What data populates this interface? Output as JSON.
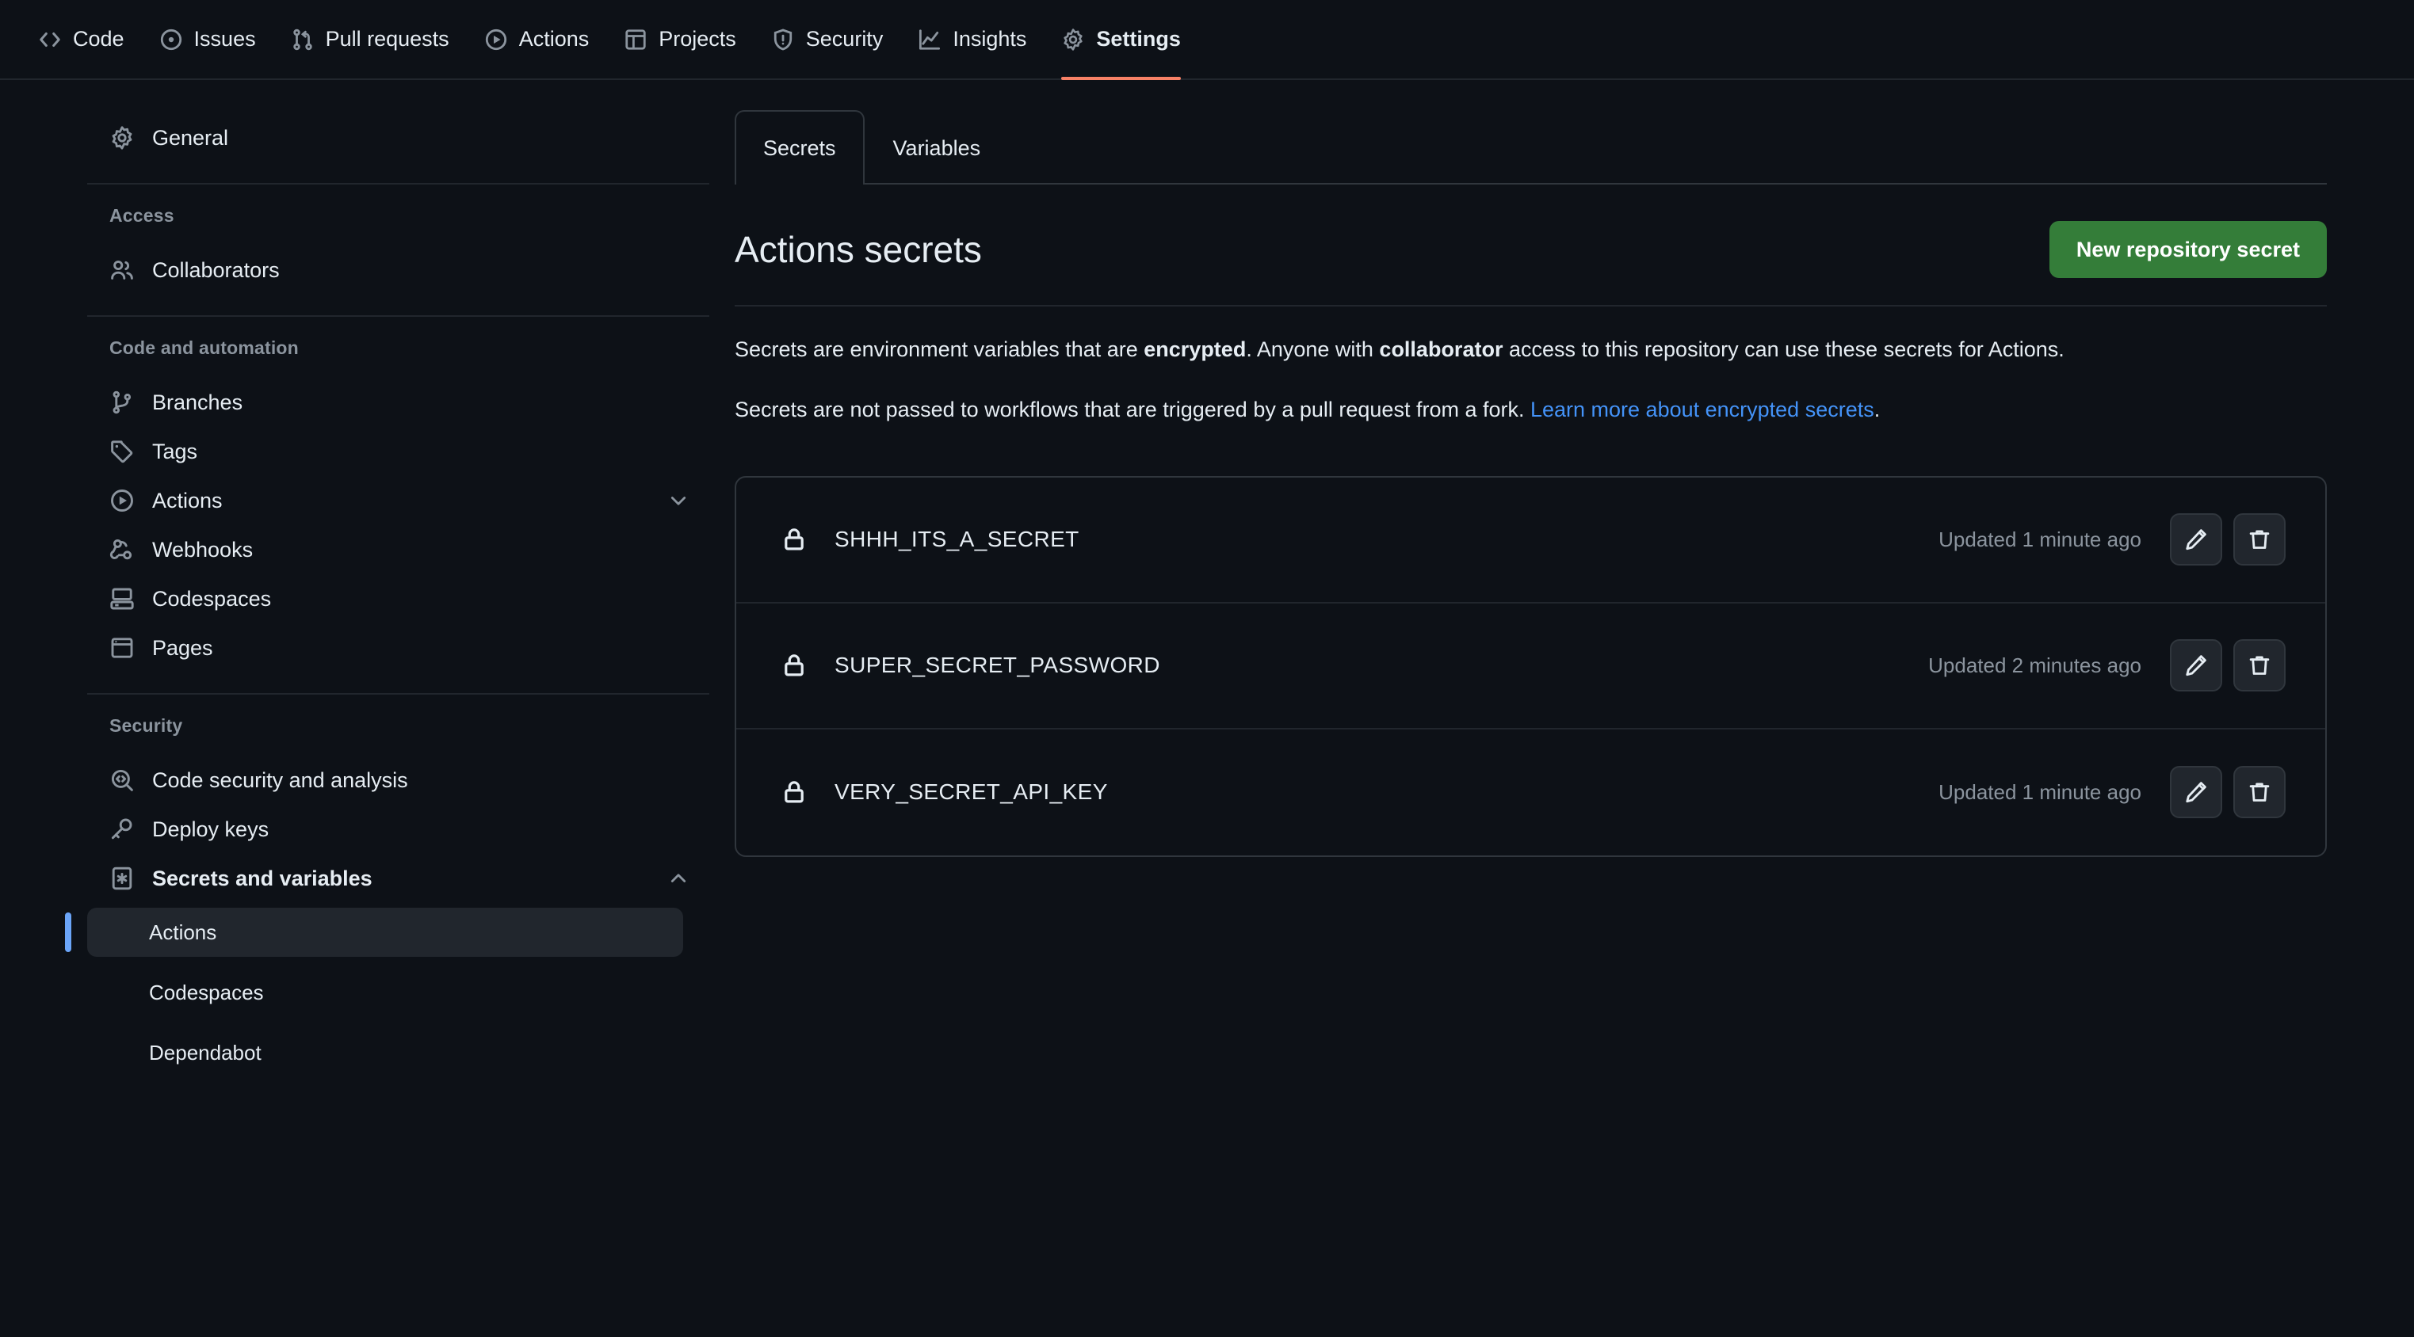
{
  "topnav": {
    "items": [
      {
        "label": "Code",
        "icon": "code-icon",
        "active": false
      },
      {
        "label": "Issues",
        "icon": "issue-opened-icon",
        "active": false
      },
      {
        "label": "Pull requests",
        "icon": "git-pull-request-icon",
        "active": false
      },
      {
        "label": "Actions",
        "icon": "play-circle-icon",
        "active": false
      },
      {
        "label": "Projects",
        "icon": "table-icon",
        "active": false
      },
      {
        "label": "Security",
        "icon": "shield-icon",
        "active": false
      },
      {
        "label": "Insights",
        "icon": "graph-icon",
        "active": false
      },
      {
        "label": "Settings",
        "icon": "gear-icon",
        "active": true
      }
    ],
    "active_indicator_color": "#f78166"
  },
  "sidebar": {
    "general": {
      "label": "General",
      "icon": "gear-icon"
    },
    "sections": [
      {
        "heading": "Access",
        "items": [
          {
            "label": "Collaborators",
            "icon": "people-icon"
          }
        ]
      },
      {
        "heading": "Code and automation",
        "items": [
          {
            "label": "Branches",
            "icon": "git-branch-icon"
          },
          {
            "label": "Tags",
            "icon": "tag-icon"
          },
          {
            "label": "Actions",
            "icon": "play-circle-icon",
            "chevron": "chevron-down"
          },
          {
            "label": "Webhooks",
            "icon": "webhook-icon"
          },
          {
            "label": "Codespaces",
            "icon": "codespaces-icon"
          },
          {
            "label": "Pages",
            "icon": "browser-icon"
          }
        ]
      },
      {
        "heading": "Security",
        "items": [
          {
            "label": "Code security and analysis",
            "icon": "code-search-icon"
          },
          {
            "label": "Deploy keys",
            "icon": "key-icon"
          },
          {
            "label": "Secrets and variables",
            "icon": "asterisk-box-icon",
            "chevron": "chevron-up",
            "bold": true
          }
        ]
      }
    ],
    "secrets_sub_items": [
      {
        "label": "Actions",
        "current": true
      },
      {
        "label": "Codespaces",
        "current": false
      },
      {
        "label": "Dependabot",
        "current": false
      }
    ],
    "active_marker_color": "#6ba5f8"
  },
  "main": {
    "tabs": [
      {
        "label": "Secrets",
        "active": true
      },
      {
        "label": "Variables",
        "active": false
      }
    ],
    "title": "Actions secrets",
    "new_secret_button": "New repository secret",
    "new_secret_button_color": "#347d39",
    "paragraph1": {
      "part1": "Secrets are environment variables that are ",
      "bold1": "encrypted",
      "part2": ". Anyone with ",
      "bold2": "collaborator",
      "part3": " access to this repository can use these secrets for Actions."
    },
    "paragraph2": {
      "text": "Secrets are not passed to workflows that are triggered by a pull request from a fork. ",
      "link": "Learn more about encrypted secrets",
      "period": ".",
      "link_color": "#4493f8"
    },
    "secrets": [
      {
        "name": "SHHH_ITS_A_SECRET",
        "updated": "Updated 1 minute ago",
        "icon": "lock-icon"
      },
      {
        "name": "SUPER_SECRET_PASSWORD",
        "updated": "Updated 2 minutes ago",
        "icon": "lock-icon"
      },
      {
        "name": "VERY_SECRET_API_KEY",
        "updated": "Updated 1 minute ago",
        "icon": "lock-icon"
      }
    ],
    "row_actions": {
      "edit": "pencil-icon",
      "delete": "trash-icon"
    }
  }
}
